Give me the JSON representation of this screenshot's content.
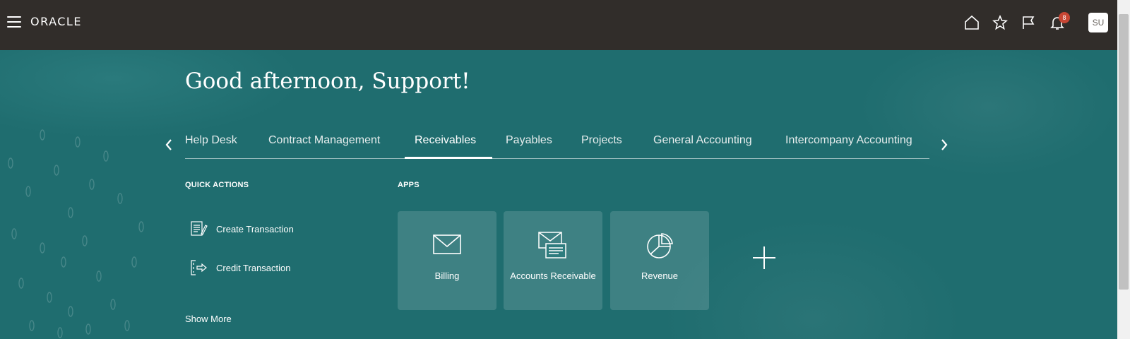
{
  "header": {
    "logo_text": "ORACLE",
    "icons": [
      "menu-icon",
      "home-icon",
      "star-icon",
      "flag-icon",
      "bell-icon"
    ],
    "notification_count": "8",
    "avatar_initials": "SU"
  },
  "greeting": "Good afternoon, Support!",
  "tabs": [
    {
      "label": "Help Desk"
    },
    {
      "label": "Contract Management"
    },
    {
      "label": "Receivables",
      "active": true
    },
    {
      "label": "Payables"
    },
    {
      "label": "Projects"
    },
    {
      "label": "General Accounting"
    },
    {
      "label": "Intercompany Accounting"
    }
  ],
  "quick_actions": {
    "title": "QUICK ACTIONS",
    "items": [
      {
        "label": "Create Transaction",
        "icon": "create-transaction-icon"
      },
      {
        "label": "Credit Transaction",
        "icon": "credit-transaction-icon"
      }
    ],
    "show_more": "Show More"
  },
  "apps": {
    "title": "APPS",
    "items": [
      {
        "label": "Billing",
        "icon": "envelope-icon"
      },
      {
        "label": "Accounts Receivable",
        "icon": "accounts-receivable-icon"
      },
      {
        "label": "Revenue",
        "icon": "pie-chart-icon"
      }
    ]
  },
  "colors": {
    "topbar": "#312d2a",
    "hero": "#1f6d6f",
    "badge": "#c74634"
  }
}
